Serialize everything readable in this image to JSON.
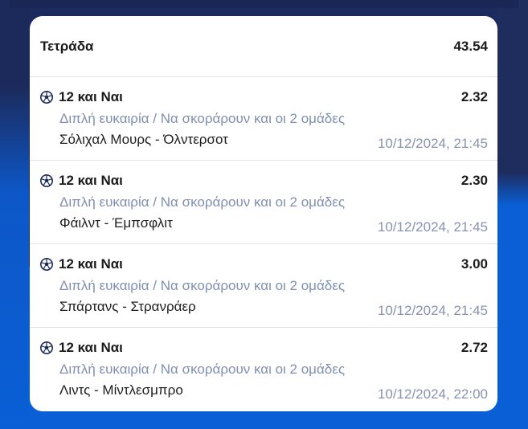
{
  "bet": {
    "type_label": "Τετράδα",
    "total_odds": "43.54"
  },
  "selections": [
    {
      "pick": "12 και Ναι",
      "odds": "2.32",
      "market": "Διπλή ευκαιρία / Να σκοράρουν και οι 2 ομάδες",
      "match": "Σόλιχαλ Μουρς - Όλντερσοτ",
      "datetime": "10/12/2024, 21:45",
      "icon": "soccer-ball-icon"
    },
    {
      "pick": "12 και Ναι",
      "odds": "2.30",
      "market": "Διπλή ευκαιρία / Να σκοράρουν και οι 2 ομάδες",
      "match": "Φάιλντ - Έμπσφλιτ",
      "datetime": "10/12/2024, 21:45",
      "icon": "soccer-ball-icon"
    },
    {
      "pick": "12 και Ναι",
      "odds": "3.00",
      "market": "Διπλή ευκαιρία / Να σκοράρουν και οι 2 ομάδες",
      "match": "Σπάρτανς - Στρανράερ",
      "datetime": "10/12/2024, 21:45",
      "icon": "soccer-ball-icon"
    },
    {
      "pick": "12 και Ναι",
      "odds": "2.72",
      "market": "Διπλή ευκαιρία / Να σκοράρουν και οι 2 ομάδες",
      "match": "Λιντς - Μίντλεσμπρο",
      "datetime": "10/12/2024, 22:00",
      "icon": "soccer-ball-icon"
    }
  ],
  "colors": {
    "background_dark": "#1c2b5e",
    "background_blue": "#0a5fd6",
    "card": "#ffffff",
    "text_primary": "#1b1b1b",
    "text_market": "#7f8fb3",
    "text_date": "#8793b0"
  }
}
